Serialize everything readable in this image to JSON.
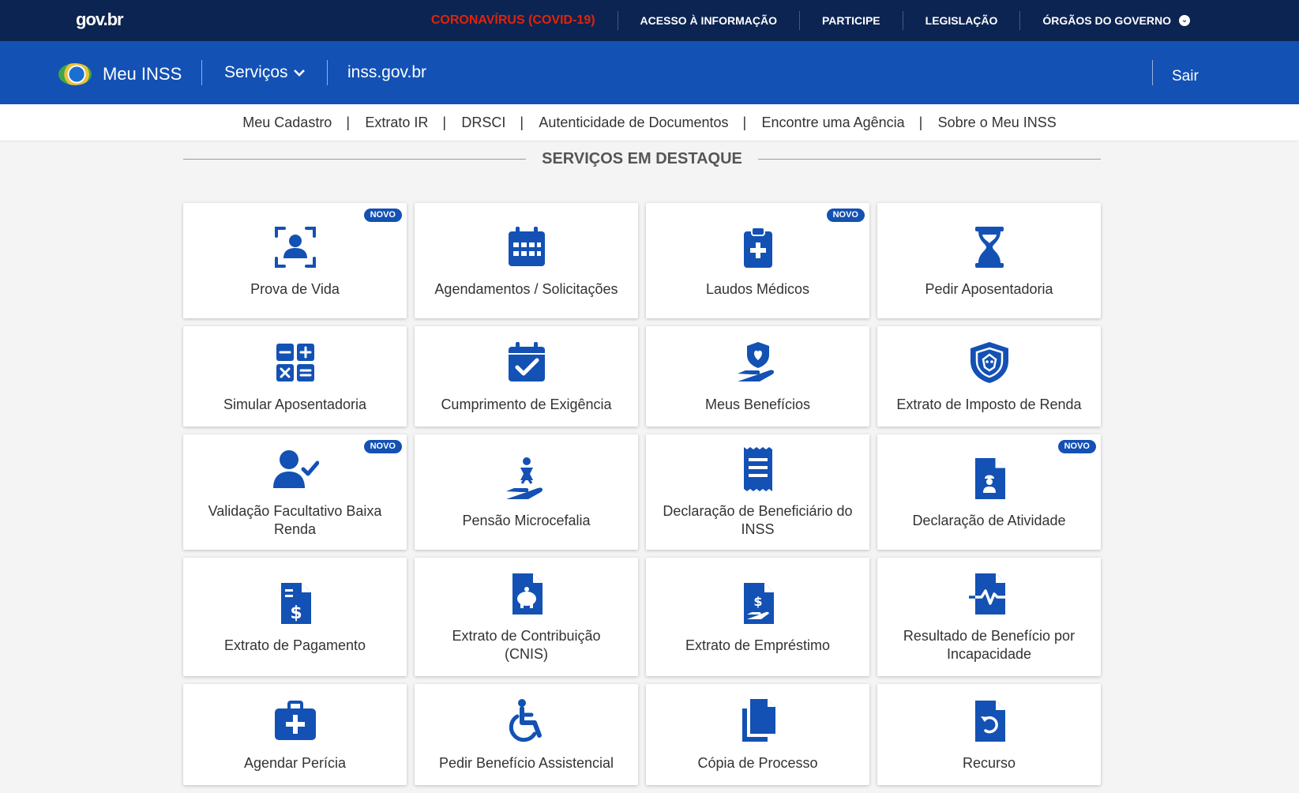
{
  "govbar": {
    "logo": "gov.br",
    "links": [
      "CORONAVÍRUS (COVID-19)",
      "ACESSO À INFORMAÇÃO",
      "PARTICIPE",
      "LEGISLAÇÃO",
      "ÓRGÃOS DO GOVERNO"
    ],
    "covid_color": "#e52207"
  },
  "header": {
    "brand": "Meu INSS",
    "servicos": "Serviços",
    "site": "inss.gov.br",
    "logout": "Sair",
    "accent": "#1351b4"
  },
  "subnav": [
    "Meu Cadastro",
    "Extrato IR",
    "DRSCI",
    "Autenticidade de Documentos",
    "Encontre uma Agência",
    "Sobre o Meu INSS"
  ],
  "section": {
    "title": "SERVIÇOS EM DESTAQUE"
  },
  "badge_label": "NOVO",
  "services": [
    {
      "label": "Prova de Vida",
      "icon": "face-scan-icon",
      "new": true
    },
    {
      "label": "Agendamentos / Solicitações",
      "icon": "calendar-icon",
      "new": false
    },
    {
      "label": "Laudos Médicos",
      "icon": "clipboard-medical-icon",
      "new": true
    },
    {
      "label": "Pedir Aposentadoria",
      "icon": "hourglass-icon",
      "new": false
    },
    {
      "label": "Simular Aposentadoria",
      "icon": "calculator-icon",
      "new": false
    },
    {
      "label": "Cumprimento de Exigência",
      "icon": "calendar-check-icon",
      "new": false
    },
    {
      "label": "Meus Benefícios",
      "icon": "hand-shield-icon",
      "new": false
    },
    {
      "label": "Extrato de Imposto de Renda",
      "icon": "lion-shield-icon",
      "new": false
    },
    {
      "label": "Validação Facultativo Baixa Renda",
      "icon": "user-check-icon",
      "new": true
    },
    {
      "label": "Pensão Microcefalia",
      "icon": "hand-child-icon",
      "new": false
    },
    {
      "label": "Declaração de Beneficiário do INSS",
      "icon": "receipt-icon",
      "new": false
    },
    {
      "label": "Declaração de Atividade",
      "icon": "worker-document-icon",
      "new": true
    },
    {
      "label": "Extrato de Pagamento",
      "icon": "payment-document-icon",
      "new": false
    },
    {
      "label": "Extrato de Contribuição (CNIS)",
      "icon": "piggy-document-icon",
      "new": false
    },
    {
      "label": "Extrato de Empréstimo",
      "icon": "loan-document-icon",
      "new": false
    },
    {
      "label": "Resultado de Benefício por Incapacidade",
      "icon": "health-document-icon",
      "new": false
    },
    {
      "label": "Agendar Perícia",
      "icon": "medical-kit-icon",
      "new": false
    },
    {
      "label": "Pedir Benefício Assistencial",
      "icon": "wheelchair-icon",
      "new": false
    },
    {
      "label": "Cópia de Processo",
      "icon": "copy-documents-icon",
      "new": false
    },
    {
      "label": "Recurso",
      "icon": "undo-document-icon",
      "new": false
    }
  ]
}
